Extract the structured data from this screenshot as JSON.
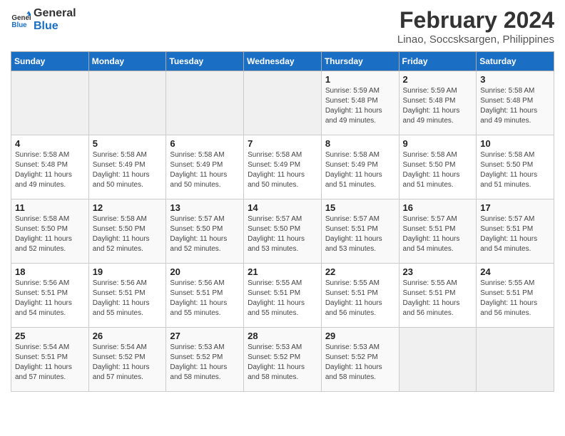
{
  "logo": {
    "line1": "General",
    "line2": "Blue"
  },
  "title": "February 2024",
  "subtitle": "Linao, Soccsksargen, Philippines",
  "headers": [
    "Sunday",
    "Monday",
    "Tuesday",
    "Wednesday",
    "Thursday",
    "Friday",
    "Saturday"
  ],
  "weeks": [
    [
      {
        "day": "",
        "info": ""
      },
      {
        "day": "",
        "info": ""
      },
      {
        "day": "",
        "info": ""
      },
      {
        "day": "",
        "info": ""
      },
      {
        "day": "1",
        "info": "Sunrise: 5:59 AM\nSunset: 5:48 PM\nDaylight: 11 hours\nand 49 minutes."
      },
      {
        "day": "2",
        "info": "Sunrise: 5:59 AM\nSunset: 5:48 PM\nDaylight: 11 hours\nand 49 minutes."
      },
      {
        "day": "3",
        "info": "Sunrise: 5:58 AM\nSunset: 5:48 PM\nDaylight: 11 hours\nand 49 minutes."
      }
    ],
    [
      {
        "day": "4",
        "info": "Sunrise: 5:58 AM\nSunset: 5:48 PM\nDaylight: 11 hours\nand 49 minutes."
      },
      {
        "day": "5",
        "info": "Sunrise: 5:58 AM\nSunset: 5:49 PM\nDaylight: 11 hours\nand 50 minutes."
      },
      {
        "day": "6",
        "info": "Sunrise: 5:58 AM\nSunset: 5:49 PM\nDaylight: 11 hours\nand 50 minutes."
      },
      {
        "day": "7",
        "info": "Sunrise: 5:58 AM\nSunset: 5:49 PM\nDaylight: 11 hours\nand 50 minutes."
      },
      {
        "day": "8",
        "info": "Sunrise: 5:58 AM\nSunset: 5:49 PM\nDaylight: 11 hours\nand 51 minutes."
      },
      {
        "day": "9",
        "info": "Sunrise: 5:58 AM\nSunset: 5:50 PM\nDaylight: 11 hours\nand 51 minutes."
      },
      {
        "day": "10",
        "info": "Sunrise: 5:58 AM\nSunset: 5:50 PM\nDaylight: 11 hours\nand 51 minutes."
      }
    ],
    [
      {
        "day": "11",
        "info": "Sunrise: 5:58 AM\nSunset: 5:50 PM\nDaylight: 11 hours\nand 52 minutes."
      },
      {
        "day": "12",
        "info": "Sunrise: 5:58 AM\nSunset: 5:50 PM\nDaylight: 11 hours\nand 52 minutes."
      },
      {
        "day": "13",
        "info": "Sunrise: 5:57 AM\nSunset: 5:50 PM\nDaylight: 11 hours\nand 52 minutes."
      },
      {
        "day": "14",
        "info": "Sunrise: 5:57 AM\nSunset: 5:50 PM\nDaylight: 11 hours\nand 53 minutes."
      },
      {
        "day": "15",
        "info": "Sunrise: 5:57 AM\nSunset: 5:51 PM\nDaylight: 11 hours\nand 53 minutes."
      },
      {
        "day": "16",
        "info": "Sunrise: 5:57 AM\nSunset: 5:51 PM\nDaylight: 11 hours\nand 54 minutes."
      },
      {
        "day": "17",
        "info": "Sunrise: 5:57 AM\nSunset: 5:51 PM\nDaylight: 11 hours\nand 54 minutes."
      }
    ],
    [
      {
        "day": "18",
        "info": "Sunrise: 5:56 AM\nSunset: 5:51 PM\nDaylight: 11 hours\nand 54 minutes."
      },
      {
        "day": "19",
        "info": "Sunrise: 5:56 AM\nSunset: 5:51 PM\nDaylight: 11 hours\nand 55 minutes."
      },
      {
        "day": "20",
        "info": "Sunrise: 5:56 AM\nSunset: 5:51 PM\nDaylight: 11 hours\nand 55 minutes."
      },
      {
        "day": "21",
        "info": "Sunrise: 5:55 AM\nSunset: 5:51 PM\nDaylight: 11 hours\nand 55 minutes."
      },
      {
        "day": "22",
        "info": "Sunrise: 5:55 AM\nSunset: 5:51 PM\nDaylight: 11 hours\nand 56 minutes."
      },
      {
        "day": "23",
        "info": "Sunrise: 5:55 AM\nSunset: 5:51 PM\nDaylight: 11 hours\nand 56 minutes."
      },
      {
        "day": "24",
        "info": "Sunrise: 5:55 AM\nSunset: 5:51 PM\nDaylight: 11 hours\nand 56 minutes."
      }
    ],
    [
      {
        "day": "25",
        "info": "Sunrise: 5:54 AM\nSunset: 5:51 PM\nDaylight: 11 hours\nand 57 minutes."
      },
      {
        "day": "26",
        "info": "Sunrise: 5:54 AM\nSunset: 5:52 PM\nDaylight: 11 hours\nand 57 minutes."
      },
      {
        "day": "27",
        "info": "Sunrise: 5:53 AM\nSunset: 5:52 PM\nDaylight: 11 hours\nand 58 minutes."
      },
      {
        "day": "28",
        "info": "Sunrise: 5:53 AM\nSunset: 5:52 PM\nDaylight: 11 hours\nand 58 minutes."
      },
      {
        "day": "29",
        "info": "Sunrise: 5:53 AM\nSunset: 5:52 PM\nDaylight: 11 hours\nand 58 minutes."
      },
      {
        "day": "",
        "info": ""
      },
      {
        "day": "",
        "info": ""
      }
    ]
  ]
}
